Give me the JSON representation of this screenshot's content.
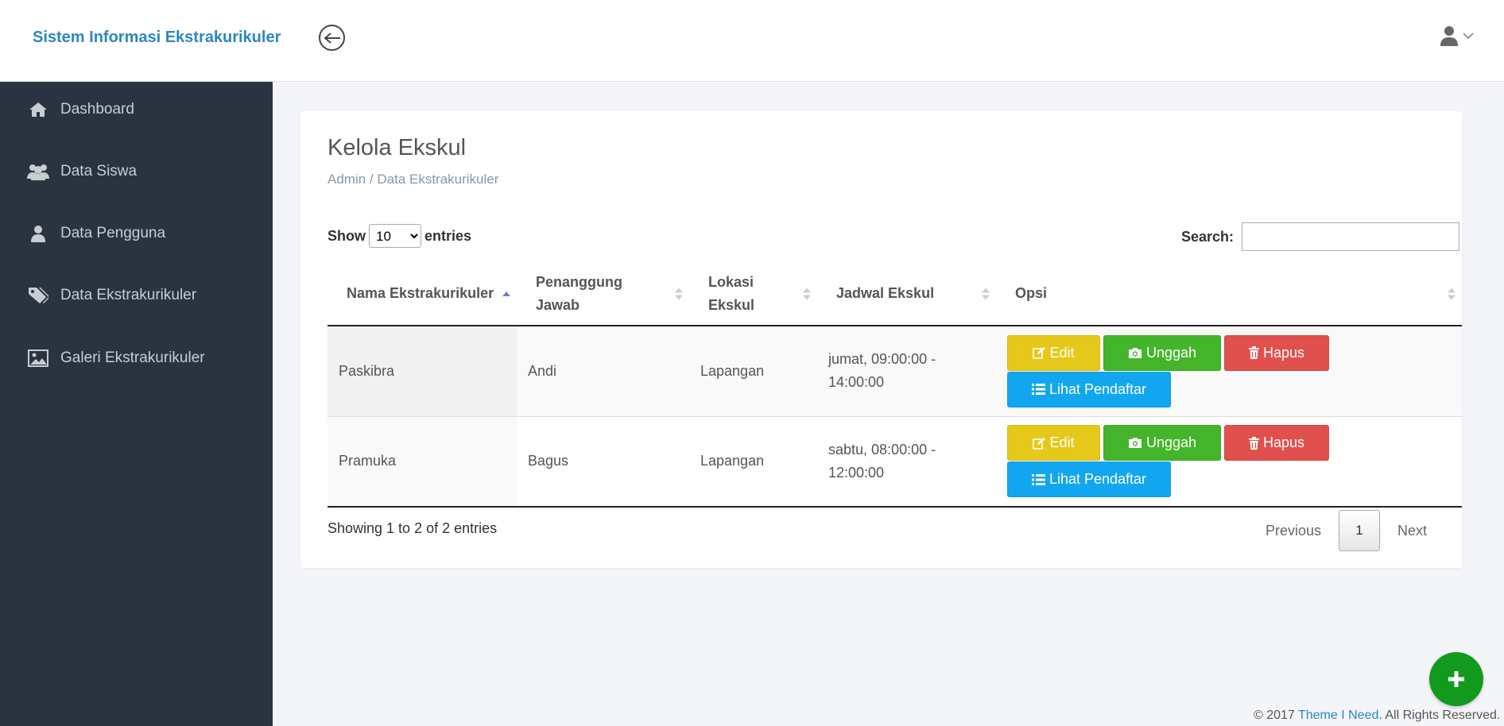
{
  "header": {
    "brand": "Sistem Informasi Ekstrakurikuler"
  },
  "sidebar": {
    "items": [
      {
        "label": "Dashboard",
        "icon": "home-icon"
      },
      {
        "label": "Data Siswa",
        "icon": "users-icon"
      },
      {
        "label": "Data Pengguna",
        "icon": "user-icon"
      },
      {
        "label": "Data Ekstrakurikuler",
        "icon": "tags-icon"
      },
      {
        "label": "Galeri Ekstrakurikuler",
        "icon": "image-icon"
      }
    ]
  },
  "main": {
    "title": "Kelola Ekskul",
    "breadcrumb": "Admin / Data Ekstrakurikuler",
    "length": {
      "show_label": "Show",
      "value": "10",
      "entries_label": "entries"
    },
    "search": {
      "label": "Search:",
      "value": ""
    },
    "table": {
      "columns": [
        "Nama Ekstrakurikuler",
        "Penanggung Jawab",
        "Lokasi Ekskul",
        "Jadwal Ekskul",
        "Opsi"
      ],
      "rows": [
        {
          "nama": "Paskibra",
          "pj": "Andi",
          "lokasi": "Lapangan",
          "jadwal": "jumat, 09:00:00 - 14:00:00"
        },
        {
          "nama": "Pramuka",
          "pj": "Bagus",
          "lokasi": "Lapangan",
          "jadwal": "sabtu, 08:00:00 - 12:00:00"
        }
      ],
      "actions": {
        "edit": "Edit",
        "upload": "Unggah",
        "delete": "Hapus",
        "list": "Lihat Pendaftar"
      }
    },
    "info": "Showing 1 to 2 of 2 entries",
    "pagination": {
      "previous": "Previous",
      "current": "1",
      "next": "Next"
    }
  },
  "footer": {
    "prefix": "© 2017 ",
    "link": "Theme I Need",
    "suffix": ". All Rights Reserved."
  },
  "colors": {
    "brand": "#2e86c1",
    "sidebar_bg": "#2a3340",
    "edit": "#e5c81a",
    "upload": "#44b52a",
    "delete": "#e0514d",
    "list": "#12a6f0",
    "fab": "#129a1f"
  }
}
